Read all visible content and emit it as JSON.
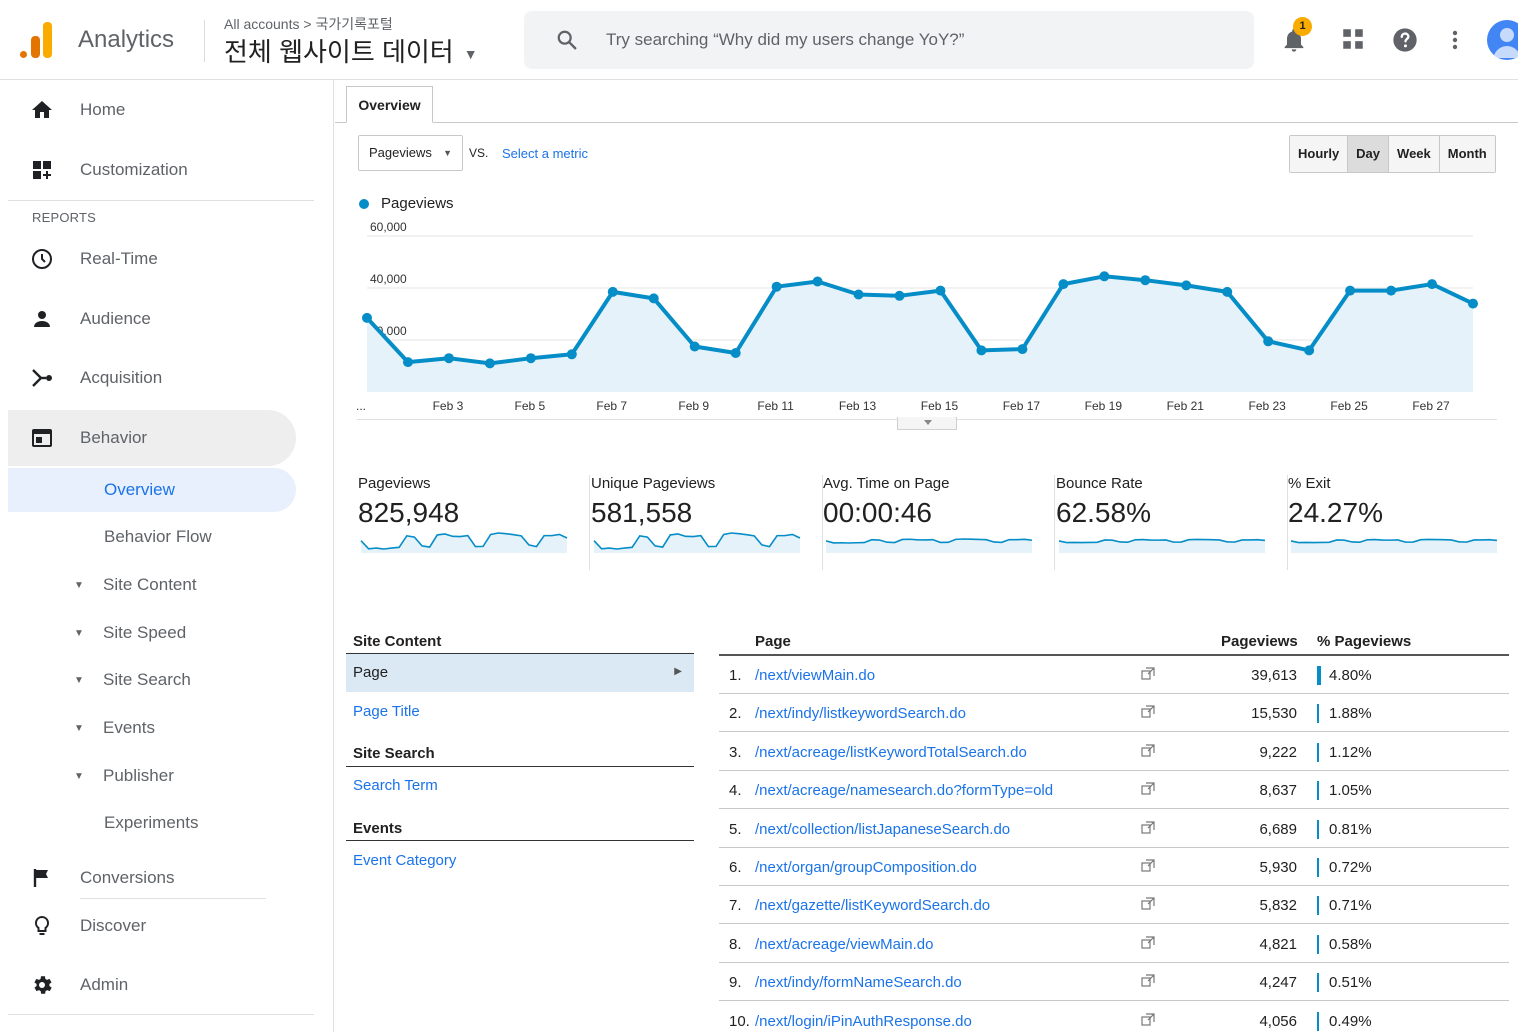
{
  "header": {
    "app_name": "Analytics",
    "breadcrumb": "All accounts > 국가기록포털",
    "property": "전체 웹사이트 데이터",
    "search_placeholder": "Try searching “Why did my users change YoY?”",
    "notification_count": "1"
  },
  "sidebar": {
    "items": [
      {
        "label": "Home",
        "icon": "home-icon"
      },
      {
        "label": "Customization",
        "icon": "dashboard-icon"
      },
      {
        "label": "Real-Time",
        "icon": "clock-icon"
      },
      {
        "label": "Audience",
        "icon": "person-icon"
      },
      {
        "label": "Acquisition",
        "icon": "acquisition-icon"
      },
      {
        "label": "Behavior",
        "icon": "behavior-icon"
      },
      {
        "label": "Conversions",
        "icon": "flag-icon"
      },
      {
        "label": "Discover",
        "icon": "lightbulb-icon"
      },
      {
        "label": "Admin",
        "icon": "gear-icon"
      }
    ],
    "reports_label": "REPORTS",
    "behavior_sub": [
      {
        "label": "Overview"
      },
      {
        "label": "Behavior Flow"
      },
      {
        "label": "Site Content"
      },
      {
        "label": "Site Speed"
      },
      {
        "label": "Site Search"
      },
      {
        "label": "Events"
      },
      {
        "label": "Publisher"
      },
      {
        "label": "Experiments"
      }
    ]
  },
  "main": {
    "tab": "Overview",
    "metric_select": "Pageviews",
    "vs": "VS.",
    "select_metric": "Select a metric",
    "periods": [
      "Hourly",
      "Day",
      "Week",
      "Month"
    ],
    "selected_period": "Day",
    "legend": "Pageviews"
  },
  "chart_data": {
    "type": "area",
    "series": [
      {
        "name": "Pageviews",
        "values": [
          28500,
          11500,
          13000,
          11000,
          13000,
          14500,
          38500,
          36000,
          17500,
          15000,
          40500,
          42500,
          37500,
          37000,
          39000,
          16000,
          16500,
          41500,
          44500,
          43000,
          41000,
          38500,
          19500,
          16000,
          39000,
          39000,
          41500,
          34000
        ]
      }
    ],
    "x_tick_labels": [
      "...",
      "Feb 3",
      "Feb 5",
      "Feb 7",
      "Feb 9",
      "Feb 11",
      "Feb 13",
      "Feb 15",
      "Feb 17",
      "Feb 19",
      "Feb 21",
      "Feb 23",
      "Feb 25",
      "Feb 27"
    ],
    "y_tick_labels": [
      "20,000",
      "40,000",
      "60,000"
    ],
    "ylim": [
      0,
      60000
    ],
    "color": "#058dc7"
  },
  "scorecards": [
    {
      "label": "Pageviews",
      "value": "825,948"
    },
    {
      "label": "Unique Pageviews",
      "value": "581,558"
    },
    {
      "label": "Avg. Time on Page",
      "value": "00:00:46"
    },
    {
      "label": "Bounce Rate",
      "value": "62.58%"
    },
    {
      "label": "% Exit",
      "value": "24.27%"
    }
  ],
  "dimensions": {
    "site_content_head": "Site Content",
    "page": "Page",
    "page_title": "Page Title",
    "site_search_head": "Site Search",
    "search_term": "Search Term",
    "events_head": "Events",
    "event_category": "Event Category"
  },
  "table": {
    "headers": {
      "page": "Page",
      "pageviews": "Pageviews",
      "pct": "% Pageviews"
    },
    "rows": [
      {
        "idx": "1.",
        "page": "/next/viewMain.do",
        "pageviews": "39,613",
        "pct": "4.80%"
      },
      {
        "idx": "2.",
        "page": "/next/indy/listkeywordSearch.do",
        "pageviews": "15,530",
        "pct": "1.88%"
      },
      {
        "idx": "3.",
        "page": "/next/acreage/listKeywordTotalSearch.do",
        "pageviews": "9,222",
        "pct": "1.12%"
      },
      {
        "idx": "4.",
        "page": "/next/acreage/namesearch.do?formType=old",
        "pageviews": "8,637",
        "pct": "1.05%"
      },
      {
        "idx": "5.",
        "page": "/next/collection/listJapaneseSearch.do",
        "pageviews": "6,689",
        "pct": "0.81%"
      },
      {
        "idx": "6.",
        "page": "/next/organ/groupComposition.do",
        "pageviews": "5,930",
        "pct": "0.72%"
      },
      {
        "idx": "7.",
        "page": "/next/gazette/listKeywordSearch.do",
        "pageviews": "5,832",
        "pct": "0.71%"
      },
      {
        "idx": "8.",
        "page": "/next/acreage/viewMain.do",
        "pageviews": "4,821",
        "pct": "0.58%"
      },
      {
        "idx": "9.",
        "page": "/next/indy/formNameSearch.do",
        "pageviews": "4,247",
        "pct": "0.51%"
      },
      {
        "idx": "10.",
        "page": "/next/login/iPinAuthResponse.do",
        "pageviews": "4,056",
        "pct": "0.49%"
      }
    ]
  }
}
